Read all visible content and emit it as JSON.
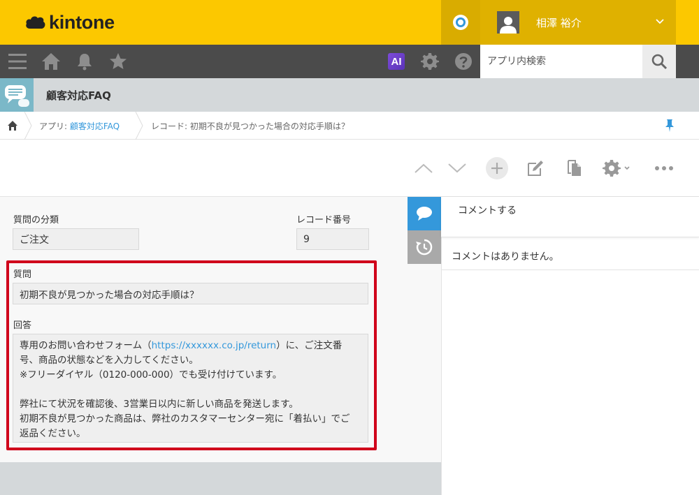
{
  "header": {
    "logo_text": "kintone",
    "user_name": "相澤 裕介"
  },
  "toolbar": {
    "ai_label": "AI",
    "search_placeholder": "アプリ内検索"
  },
  "app": {
    "title": "顧客対応FAQ"
  },
  "breadcrumb": {
    "app_prefix": "アプリ: ",
    "app_link": "顧客対応FAQ",
    "record": "レコード: 初期不良が見つかった場合の対応手順は？"
  },
  "form": {
    "category_label": "質問の分類",
    "category_value": "ご注文",
    "record_no_label": "レコード番号",
    "record_no_value": "9",
    "question_label": "質問",
    "question_value": "初期不良が見つかった場合の対応手順は？",
    "answer_label": "回答",
    "answer_line1_pre": "専用のお問い合わせフォーム（",
    "answer_link": "https://xxxxxx.co.jp/return",
    "answer_line1_post": "）に、ご注文番",
    "answer_rest": "号、商品の状態などを入力してください。\n※フリーダイヤル（0120-000-000）でも受け付けています。\n\n弊社にて状況を確認後、3営業日以内に新しい商品を発送します。\n初期不良が見つかった商品は、弊社のカスタマーセンター宛に「着払い」でご\n返品ください。"
  },
  "comments": {
    "placeholder": "コメントする",
    "empty_text": "コメントはありません。"
  },
  "colors": {
    "header_yellow": "#fcc800",
    "toolbar_gray": "#4b4b4b",
    "accent_blue": "#3498db",
    "highlight_red": "#d0021b"
  }
}
